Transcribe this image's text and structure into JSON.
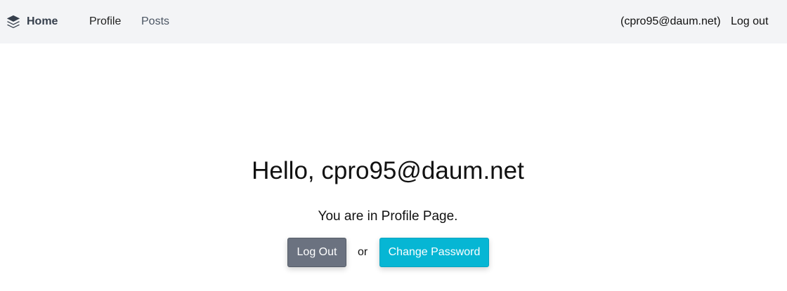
{
  "navbar": {
    "brand_icon": "layers-icon",
    "brand_label": "Home",
    "links": {
      "profile": "Profile",
      "posts": "Posts"
    },
    "user_text": "(cpro95@daum.net)",
    "logout_label": "Log out",
    "background": "#f3f4f6"
  },
  "main": {
    "greeting": "Hello, cpro95@daum.net",
    "subtitle": "You are in Profile Page.",
    "logout_button": "Log Out",
    "or_text": "or",
    "change_password_button": "Change Password"
  },
  "colors": {
    "logout_button": "#6b7280",
    "change_password_button": "#06b6d4"
  }
}
